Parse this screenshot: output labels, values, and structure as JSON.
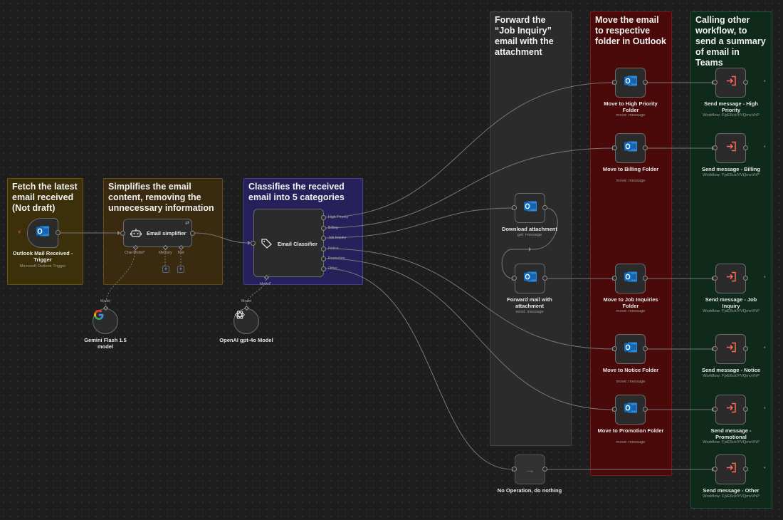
{
  "stickies": {
    "fetch": "Fetch the latest email received (Not draft)",
    "simplify": "Simplifies the email content, removing the unnecessary information",
    "classify": "Classifies the received email into 5 categories",
    "forward": "Forward the “Job Inquiry” email with the attachment",
    "move": "Move the email to respective folder in Outlook",
    "calling": "Calling other workflow, to send a summary of email in Teams"
  },
  "nodes": {
    "trigger": {
      "label": "Outlook Mail Received - Trigger",
      "sub": "Microsoft Outlook Trigger",
      "icon": "outlook-icon"
    },
    "simplifier": {
      "label": "Email simplifier",
      "icon": "robot-icon",
      "ports": {
        "chat": "Chat Model*",
        "memory": "Memory",
        "tool": "Tool"
      }
    },
    "gemini": {
      "label": "Gemini Flash 1.5 model",
      "port": "Model",
      "icon": "google-icon"
    },
    "classifier": {
      "label": "Email Classifier",
      "icon": "tag-icon",
      "port": "Model*",
      "outputs": [
        "High Priority",
        "Billing",
        "Job Inquiry",
        "Notice",
        "Promotion",
        "Other"
      ]
    },
    "openai": {
      "label": "OpenAI gpt-4o Model",
      "port": "Model",
      "icon": "openai-icon"
    },
    "download": {
      "label": "Download attachment",
      "sub": "get: message"
    },
    "forwardmail": {
      "label": "Forward mail with attachment",
      "sub": "send: message"
    },
    "noop": {
      "label": "No Operation, do nothing",
      "icon": "arrow-right-icon"
    },
    "moves": [
      {
        "label": "Move to High Priority Folder",
        "sub": "move: message"
      },
      {
        "label": "Move to Billing Folder",
        "sub": "move: message"
      },
      {
        "label": "Move to Job Inquiries Folder",
        "sub": "move: message"
      },
      {
        "label": "Move to Notice Folder",
        "sub": "move: message"
      },
      {
        "label": "Move to Promotion Folder",
        "sub": "move: message"
      }
    ],
    "sends": [
      {
        "label": "Send message - High Priority",
        "sub": "Workflow: FjxE6cklYVQmvVhP"
      },
      {
        "label": "Send message - Billing",
        "sub": "Workflow: FjxE6cklYVQmvVhP"
      },
      {
        "label": "Send message - Job Inquiry",
        "sub": "Workflow: FjxE6cklYVQmvVhP"
      },
      {
        "label": "Send message - Notice",
        "sub": "Workflow: FjxE6cklYVQmvVhP"
      },
      {
        "label": "Send message - Promotional",
        "sub": "Workflow: FjxE6cklYVQmvVhP"
      },
      {
        "label": "Send message - Other",
        "sub": "Workflow: FjxE6cklYVQmvVhP"
      }
    ]
  },
  "colors": {
    "sticky_yellow": "#3a2f08",
    "sticky_orange": "#3a2a10",
    "sticky_purple": "#25205a",
    "sticky_gray": "#2c2c2c",
    "sticky_red": "#4a0b0b",
    "sticky_green": "#0f2a1a",
    "outlook_blue": "#1a7fd6",
    "send_orange": "#ff6d5a",
    "trigger_red": "#ff5a3c"
  }
}
